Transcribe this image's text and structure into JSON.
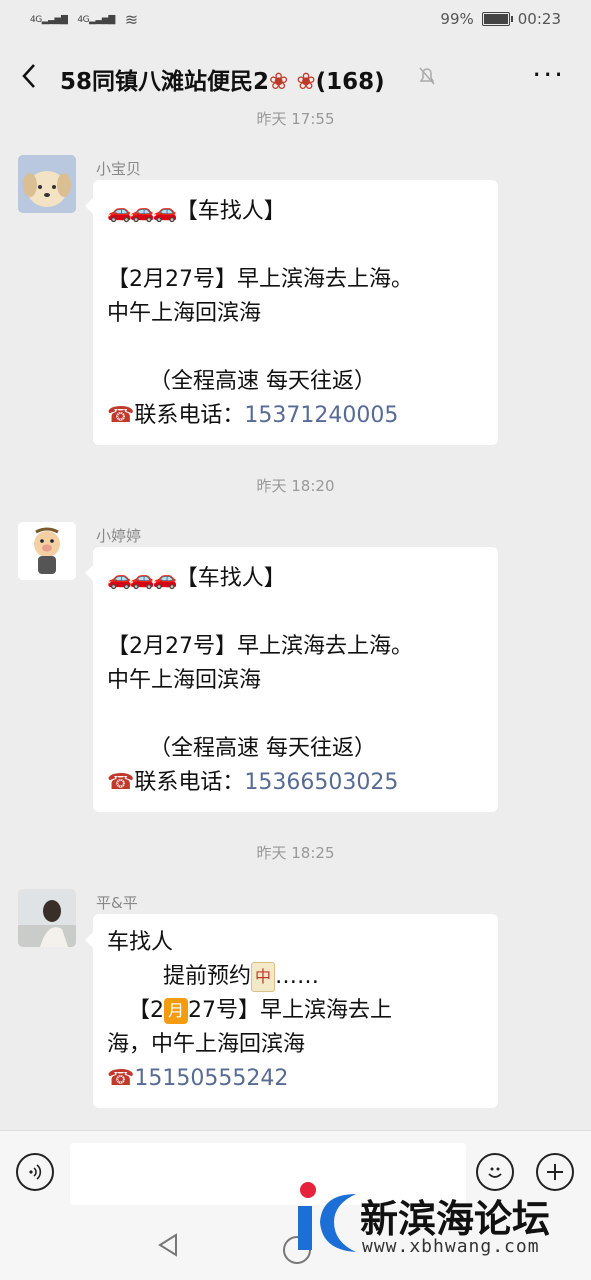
{
  "status": {
    "signal1": "4G",
    "signal2": "4G",
    "battery": "99%",
    "time": "00:23",
    "battery_level": 0.99
  },
  "header": {
    "back_icon": "chevron-left-icon",
    "title": "58同镇八滩站便民2",
    "count": "(168)",
    "mute_icon": "bell-off-icon",
    "more": "···"
  },
  "messages": [
    {
      "time": "昨天 17:55",
      "nick": "小宝贝",
      "avatar_icon": "puppy-avatar",
      "lines": [
        "【车找人】",
        "",
        "【2月27号】早上滨海去上海。",
        "中午上海回滨海",
        "",
        "      （全程高速 每天往返）",
        "联系电话："
      ],
      "phone": "15371240005"
    },
    {
      "time": "昨天 18:20",
      "nick": "小婷婷",
      "avatar_icon": "cartoon-pig-avatar",
      "lines": [
        "【车找人】",
        "",
        "【2月27号】早上滨海去上海。",
        "中午上海回滨海",
        "",
        "      （全程高速 每天往返）",
        "联系电话："
      ],
      "phone": "15366503025"
    },
    {
      "time": "昨天 18:25",
      "nick": "平&平",
      "avatar_icon": "girl-photo-avatar",
      "l1": "车找人",
      "l2": "        提前预约",
      "l2b": "……",
      "l3a": "   【2",
      "l3b": "27号】早上滨海去上",
      "l4": "海，中午上海回滨海",
      "phone": "15150555242",
      "tile": "中",
      "moon": "月"
    }
  ],
  "input": {
    "voice_icon": "voice-icon",
    "emoji_icon": "emoji-icon",
    "plus_icon": "plus-icon"
  },
  "watermark": {
    "text": "新滨海论坛",
    "url": "www.xbhwang.com"
  }
}
